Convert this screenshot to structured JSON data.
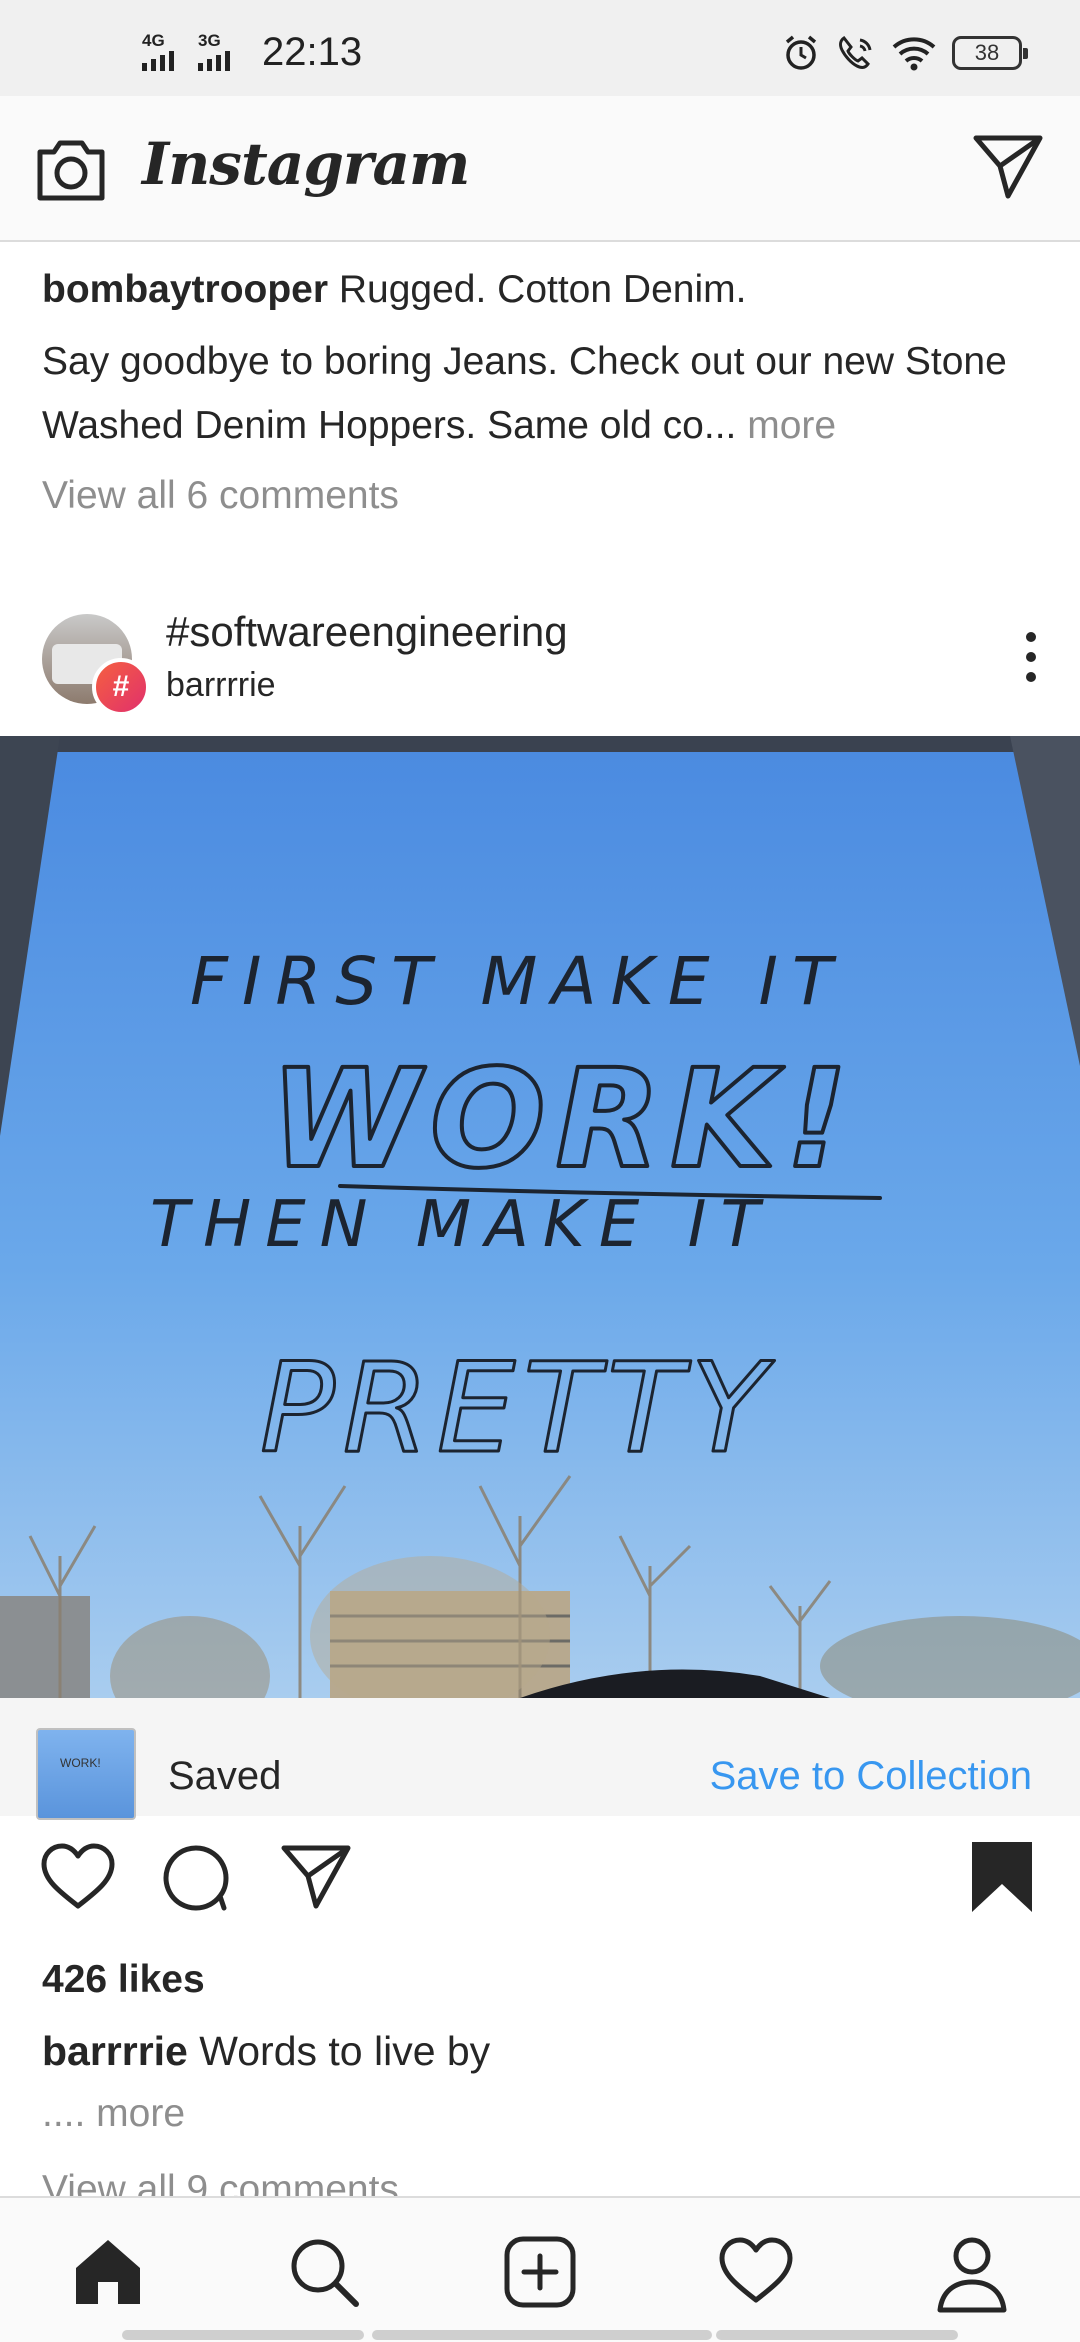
{
  "status_bar": {
    "network_1": "4G",
    "network_2": "3G",
    "time": "22:13",
    "battery": "38",
    "icons": [
      "alarm-icon",
      "wifi-call-icon",
      "wifi-icon",
      "battery-icon"
    ]
  },
  "app_bar": {
    "title": "Instagram",
    "left_icon": "camera-icon",
    "right_icon": "direct-message-icon"
  },
  "previous_post": {
    "username": "bombaytrooper",
    "caption_title": "Rugged. Cotton Denim.",
    "caption_body": "Say goodbye to boring Jeans. Check out our new Stone Washed Denim Hoppers. Same old co...",
    "more_label": "more",
    "comments_label": "View all 6 comments"
  },
  "post": {
    "title": "#softwareengineering",
    "username": "barrrrie",
    "image_text": [
      "FIRST MAKE IT",
      "WORK!",
      "THEN MAKE IT",
      "PRETTY"
    ],
    "saved_label": "Saved",
    "save_to_collection": "Save to Collection",
    "likes": "426 likes",
    "caption_user": "barrrrie",
    "caption_text": "Words to live by",
    "caption_more": ".... more",
    "comments_label": "View all 9 comments",
    "accent_color": "#3897f0"
  },
  "bottom_nav": [
    "home-icon",
    "search-icon",
    "new-post-icon",
    "activity-icon",
    "profile-icon"
  ]
}
